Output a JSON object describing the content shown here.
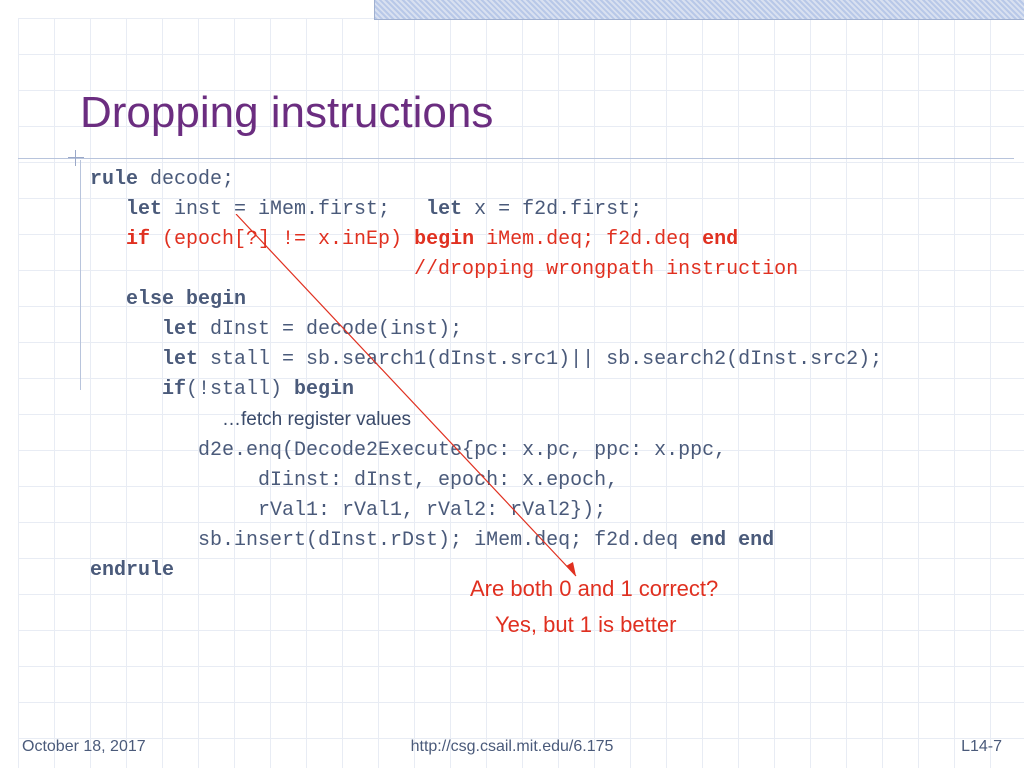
{
  "title": "Dropping instructions",
  "code": {
    "l1a": "rule",
    "l1b": " decode;",
    "l2a": "   let",
    "l2b": " inst = iMem.first;   ",
    "l2c": "let",
    "l2d": " x = f2d.first;",
    "l3a": "   if ",
    "l3b": "(epoch[?] != x.inEp) ",
    "l3c": "begin",
    "l3d": " iMem.deq; f2d.deq ",
    "l3e": "end",
    "l4": "                           //dropping wrongpath instruction",
    "l5a": "   else begin",
    "l6a": "      let",
    "l6b": " dInst = decode(inst);",
    "l7a": "      let",
    "l7b": " stall = sb.search1(dInst.src1)|| sb.search2(dInst.src2);",
    "l8a": "      if",
    "l8b": "(!stall) ",
    "l8c": "begin",
    "ann": "…fetch register values",
    "l9": "         d2e.enq(Decode2Execute{pc: x.pc, ppc: x.ppc,",
    "l10": "              dIinst: dInst, epoch: x.epoch,",
    "l11": "              rVal1: rVal1, rVal2: rVal2});",
    "l12a": "         sb.insert(dInst.rDst); iMem.deq; f2d.deq ",
    "l12b": "end end",
    "l13": "endrule"
  },
  "callouts": {
    "q": "Are both 0 and 1 correct?",
    "a": "Yes, but 1 is better"
  },
  "footer": {
    "date": "October 18, 2017",
    "url": "http://csg.csail.mit.edu/6.175",
    "page": "L14-7"
  }
}
